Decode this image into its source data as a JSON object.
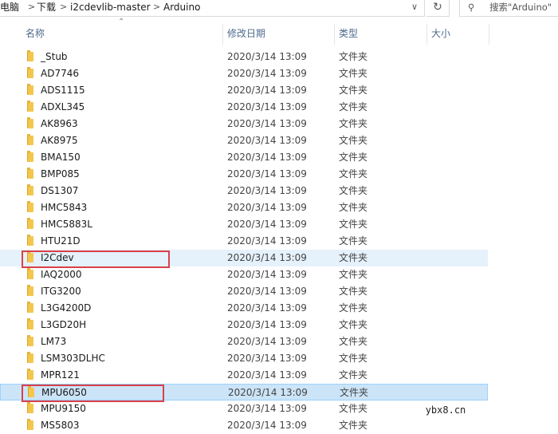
{
  "breadcrumb": [
    "电脑",
    "下载",
    "i2cdevlib-master",
    "Arduino"
  ],
  "search": {
    "placeholder": "搜索\"Arduino\""
  },
  "columns": {
    "name": "名称",
    "date": "修改日期",
    "type": "类型",
    "size": "大小"
  },
  "files": [
    {
      "name": "_Stub",
      "date": "2020/3/14 13:09",
      "type": "文件夹"
    },
    {
      "name": "AD7746",
      "date": "2020/3/14 13:09",
      "type": "文件夹"
    },
    {
      "name": "ADS1115",
      "date": "2020/3/14 13:09",
      "type": "文件夹"
    },
    {
      "name": "ADXL345",
      "date": "2020/3/14 13:09",
      "type": "文件夹"
    },
    {
      "name": "AK8963",
      "date": "2020/3/14 13:09",
      "type": "文件夹"
    },
    {
      "name": "AK8975",
      "date": "2020/3/14 13:09",
      "type": "文件夹"
    },
    {
      "name": "BMA150",
      "date": "2020/3/14 13:09",
      "type": "文件夹"
    },
    {
      "name": "BMP085",
      "date": "2020/3/14 13:09",
      "type": "文件夹"
    },
    {
      "name": "DS1307",
      "date": "2020/3/14 13:09",
      "type": "文件夹"
    },
    {
      "name": "HMC5843",
      "date": "2020/3/14 13:09",
      "type": "文件夹"
    },
    {
      "name": "HMC5883L",
      "date": "2020/3/14 13:09",
      "type": "文件夹"
    },
    {
      "name": "HTU21D",
      "date": "2020/3/14 13:09",
      "type": "文件夹"
    },
    {
      "name": "I2Cdev",
      "date": "2020/3/14 13:09",
      "type": "文件夹"
    },
    {
      "name": "IAQ2000",
      "date": "2020/3/14 13:09",
      "type": "文件夹"
    },
    {
      "name": "ITG3200",
      "date": "2020/3/14 13:09",
      "type": "文件夹"
    },
    {
      "name": "L3G4200D",
      "date": "2020/3/14 13:09",
      "type": "文件夹"
    },
    {
      "name": "L3GD20H",
      "date": "2020/3/14 13:09",
      "type": "文件夹"
    },
    {
      "name": "LM73",
      "date": "2020/3/14 13:09",
      "type": "文件夹"
    },
    {
      "name": "LSM303DLHC",
      "date": "2020/3/14 13:09",
      "type": "文件夹"
    },
    {
      "name": "MPR121",
      "date": "2020/3/14 13:09",
      "type": "文件夹"
    },
    {
      "name": "MPU6050",
      "date": "2020/3/14 13:09",
      "type": "文件夹"
    },
    {
      "name": "MPU9150",
      "date": "2020/3/14 13:09",
      "type": "文件夹"
    },
    {
      "name": "MS5803",
      "date": "2020/3/14 13:09",
      "type": "文件夹"
    }
  ],
  "watermark": "ybx8.cn",
  "colors": {
    "highlight_box": "#d9414b",
    "hover_row": "#e5f1fb",
    "selected_row": "#cce4f7",
    "folder": "#f4c64c"
  }
}
